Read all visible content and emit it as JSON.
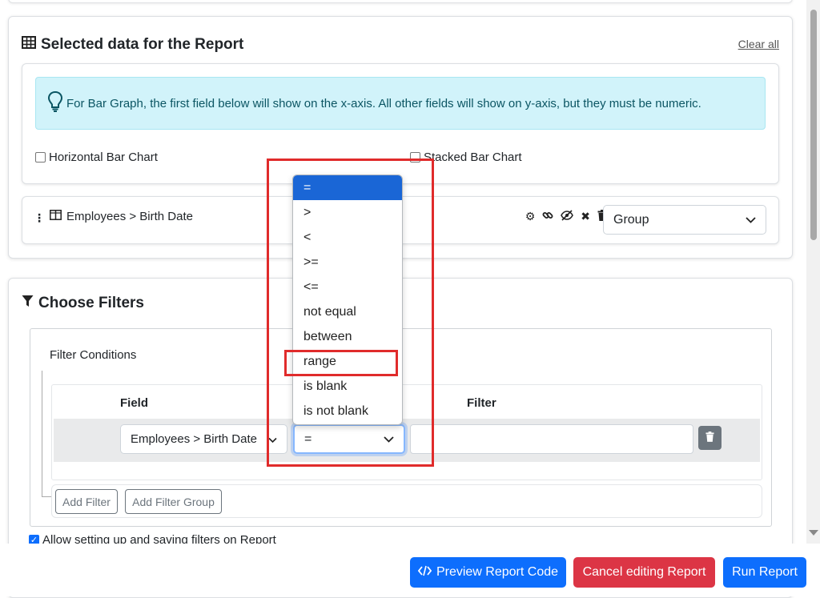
{
  "selected_data": {
    "title": "Selected data for the Report",
    "clear_all": "Clear all",
    "alert_text": "For Bar Graph, the first field below will show on the x-axis. All other fields will show on y-axis, but they must be numeric.",
    "horizontal_label": "Horizontal Bar Chart",
    "stacked_label": "Stacked Bar Chart",
    "field_label": "Employees > Birth Date",
    "aggregate_value": "Group"
  },
  "filters": {
    "title": "Choose Filters",
    "conditions_label": "Filter Conditions",
    "field_header": "Field",
    "filter_header": "Filter",
    "row_field_value": "Employees > Birth Date",
    "row_operator_value": "=",
    "row_filter_value": "",
    "add_filter": "Add Filter",
    "add_filter_group": "Add Filter Group",
    "allow_saving_label": "Allow setting up and saving filters on Report"
  },
  "operator_dropdown": {
    "options": [
      "=",
      ">",
      "<",
      ">=",
      "<=",
      "not equal",
      "between",
      "range",
      "is blank",
      "is not blank"
    ],
    "selected": "="
  },
  "footer": {
    "preview_code": "Preview Report Code",
    "cancel_editing": "Cancel editing Report",
    "run_report": "Run Report"
  },
  "colors": {
    "primary": "#0d6efd",
    "danger": "#dc3545",
    "alert_bg": "#d1f3fa",
    "highlight": "#e02b2b"
  }
}
